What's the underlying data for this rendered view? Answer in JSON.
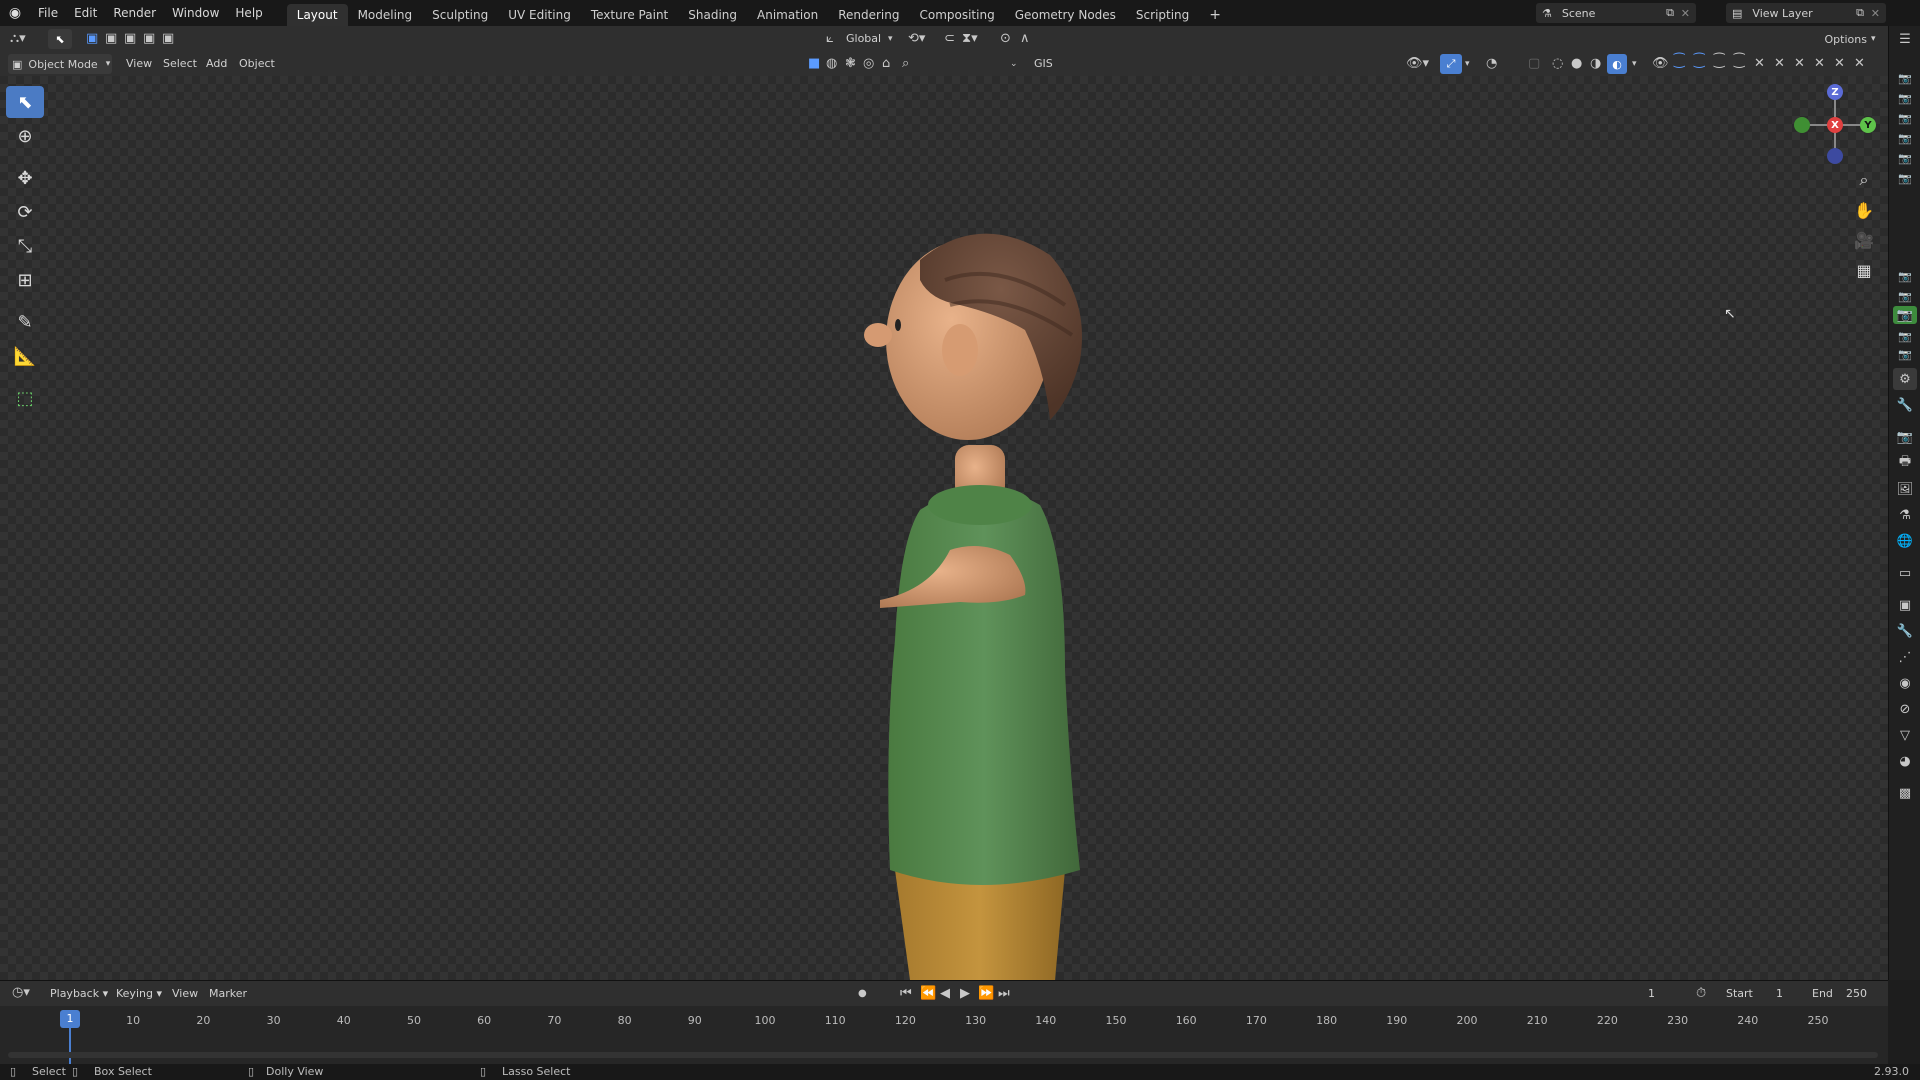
{
  "top_menu": {
    "items": [
      "File",
      "Edit",
      "Render",
      "Window",
      "Help"
    ],
    "workspaces": [
      "Layout",
      "Modeling",
      "Sculpting",
      "UV Editing",
      "Texture Paint",
      "Shading",
      "Animation",
      "Rendering",
      "Compositing",
      "Geometry Nodes",
      "Scripting"
    ],
    "active_workspace": "Layout",
    "add_tab": "+",
    "scene_name": "Scene",
    "view_layer_name": "View Layer"
  },
  "viewport_header": {
    "transform_orientation": "Global",
    "options_label": "Options",
    "mode_label": "Object Mode",
    "menus": [
      "View",
      "Select",
      "Add",
      "Object"
    ],
    "gis_label": "GIS"
  },
  "timeline": {
    "menus": [
      "Playback",
      "Keying",
      "View",
      "Marker"
    ],
    "current_frame": "1",
    "start_label": "Start",
    "start_value": "1",
    "end_label": "End",
    "end_value": "250",
    "frame_display": "1",
    "ticks": [
      "10",
      "20",
      "30",
      "40",
      "50",
      "60",
      "70",
      "80",
      "90",
      "100",
      "110",
      "120",
      "130",
      "140",
      "150",
      "160",
      "170",
      "180",
      "190",
      "200",
      "210",
      "220",
      "230",
      "240",
      "250"
    ]
  },
  "status_bar": {
    "select": "Select",
    "box_select": "Box Select",
    "dolly_view": "Dolly View",
    "lasso_select": "Lasso Select",
    "version": "2.93.0"
  },
  "gizmo": {
    "z": "Z",
    "x": "X",
    "y": "Y"
  },
  "colors": {
    "accent": "#4a7fd1",
    "active_tab_green": "#3d8c3d",
    "sweater": "#5a8a4e",
    "pants": "#b88a3a",
    "skin": "#d8a07a",
    "hair": "#6b4a38"
  }
}
